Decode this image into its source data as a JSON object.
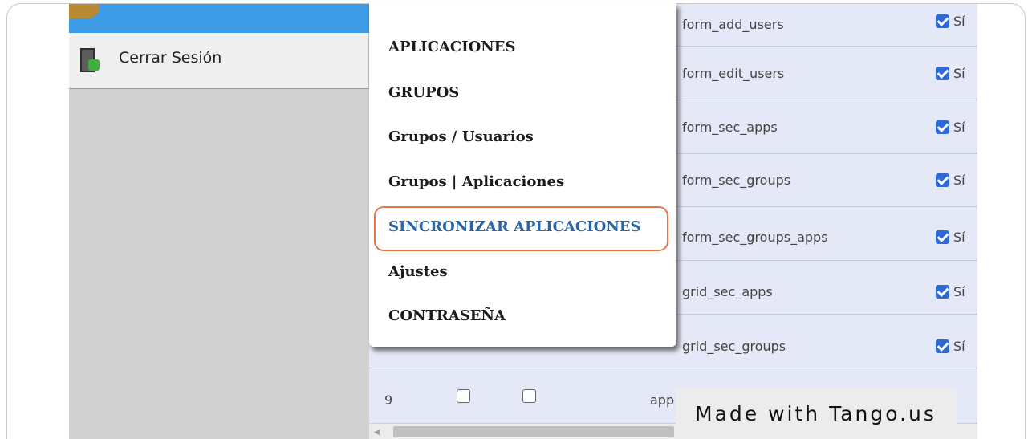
{
  "sidebar": {
    "logout_label": "Cerrar Sesión"
  },
  "menu": {
    "items": [
      {
        "label": "APLICACIONES"
      },
      {
        "label": "GRUPOS"
      },
      {
        "label": "Grupos / Usuarios"
      },
      {
        "label": "Grupos | Aplicaciones"
      },
      {
        "label": "SINCRONIZAR APLICACIONES",
        "highlighted": true
      },
      {
        "label": "Ajustes"
      },
      {
        "label": "CONTRASEÑA"
      }
    ]
  },
  "grid": {
    "rows": [
      {
        "name": "form_add_users",
        "checked": true,
        "value": "Sí"
      },
      {
        "name": "form_edit_users",
        "checked": true,
        "value": "Sí"
      },
      {
        "name": "form_sec_apps",
        "checked": true,
        "value": "Sí"
      },
      {
        "name": "form_sec_groups",
        "checked": true,
        "value": "Sí"
      },
      {
        "name": "form_sec_groups_apps",
        "checked": true,
        "value": "Sí"
      },
      {
        "name": "grid_sec_apps",
        "checked": true,
        "value": "Sí"
      },
      {
        "name": "grid_sec_groups",
        "checked": true,
        "value": "Sí"
      }
    ],
    "partial_row": {
      "number": "9",
      "name": "app"
    }
  },
  "watermark": "Made with Tango.us",
  "colors": {
    "highlight_border": "#e8744a",
    "active_menu_text": "#2b67a6",
    "sidebar_selected": "#3e9be5",
    "grid_background": "#e5e8f6"
  }
}
